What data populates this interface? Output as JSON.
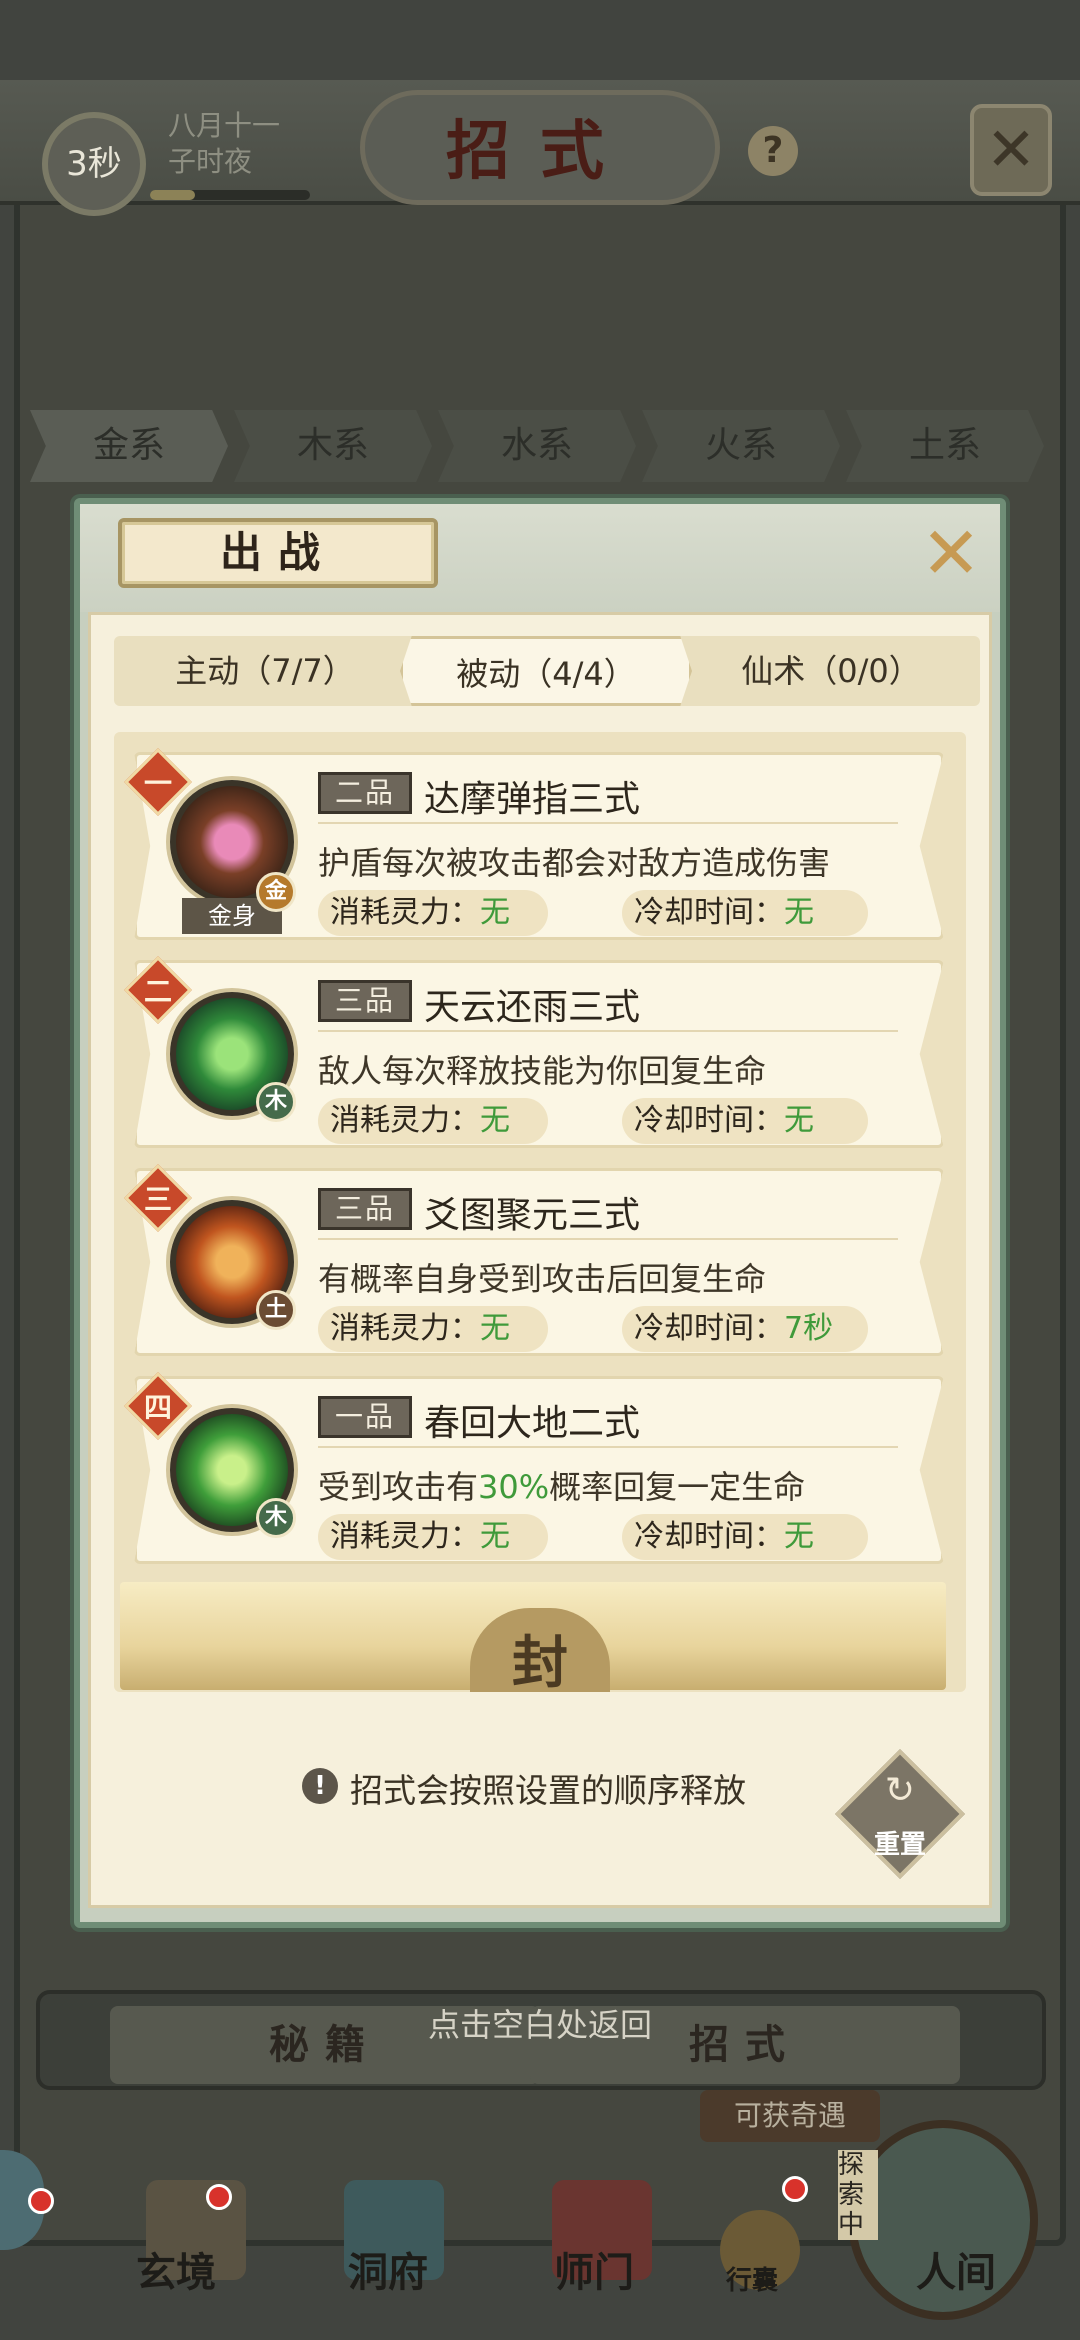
{
  "status": {
    "timer": "3秒",
    "date_line1": "八月十一",
    "date_line2": "子时夜",
    "progress": 0.28
  },
  "header": {
    "title": "招式",
    "help_icon": "question-icon",
    "close_icon": "close-icon"
  },
  "element_tabs": [
    "金系",
    "木系",
    "水系",
    "火系",
    "土系"
  ],
  "popup": {
    "title": "出战",
    "tabs": [
      "主动（7/7）",
      "被动（4/4）",
      "仙术（0/0）"
    ],
    "active_tab": 1,
    "skills": [
      {
        "index": "一",
        "grade": "二品",
        "name": "达摩弹指三式",
        "desc_pre": "护盾每次被攻击都会对敌方造成伤害",
        "desc_hl": "",
        "desc_post": "",
        "cost_label": "消耗灵力：",
        "cost": "无",
        "cd_label": "冷却时间：",
        "cd": "无",
        "element": "金",
        "badge": "金身",
        "icon": "lotus-icon"
      },
      {
        "index": "二",
        "grade": "三品",
        "name": "天云还雨三式",
        "desc_pre": "敌人每次释放技能为你回复生命",
        "desc_hl": "",
        "desc_post": "",
        "cost_label": "消耗灵力：",
        "cost": "无",
        "cd_label": "冷却时间：",
        "cd": "无",
        "element": "木",
        "badge": "",
        "icon": "green-scroll-icon"
      },
      {
        "index": "三",
        "grade": "三品",
        "name": "爻图聚元三式",
        "desc_pre": "有概率自身受到攻击后回复生命",
        "desc_hl": "",
        "desc_post": "",
        "cost_label": "消耗灵力：",
        "cost": "无",
        "cd_label": "冷却时间：",
        "cd": "7秒",
        "element": "土",
        "badge": "",
        "icon": "fire-scroll-icon"
      },
      {
        "index": "四",
        "grade": "一品",
        "name": "春回大地二式",
        "desc_pre": "受到攻击有",
        "desc_hl": "30%",
        "desc_post": "概率回复一定生命",
        "cost_label": "消耗灵力：",
        "cost": "无",
        "cd_label": "冷却时间：",
        "cd": "无",
        "element": "木",
        "badge": "",
        "icon": "vine-icon"
      }
    ],
    "seal_char": "封",
    "tip": "招式会按照设置的顺序释放",
    "reset": "重置"
  },
  "bottom": {
    "tab_left": "秘籍",
    "tab_right": "招式",
    "hint": "点击空白处返回",
    "qiyu": "可获奇遇",
    "explore": "探索中"
  },
  "nav": [
    "玄境",
    "洞府",
    "师门",
    "行囊",
    "人间"
  ],
  "colors": {
    "panel_border": "#6f8d76",
    "accent_red": "#c8492a",
    "value_green": "#3f9a3a"
  }
}
